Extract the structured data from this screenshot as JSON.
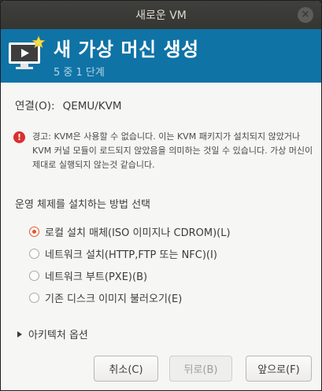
{
  "window": {
    "title": "새로운 VM",
    "close_glyph": "×"
  },
  "banner": {
    "title": "새 가상 머신 생성",
    "step": "5 중 1 단계",
    "background": "#0f73a6"
  },
  "connection": {
    "label": "연결(O):",
    "value": "QEMU/KVM"
  },
  "warning": {
    "text": "경고: KVM은 사용할 수 없습니다. 이는 KVM 패키지가 설치되지 않았거나 KVM 커널 모듈이 로드되지 않았음을 의미하는 것일 수 있습니다. 가상 머신이 제대로 실행되지 않는것 같습니다.",
    "glyph": "!"
  },
  "install_method": {
    "title": "운영 체제를 설치하는 방법 선택",
    "options": [
      {
        "label": "로컬 설치 매체(ISO 이미지나 CDROM)(L)",
        "selected": true
      },
      {
        "label": "네트워크 설치(HTTP,FTP 또는 NFC)(I)",
        "selected": false
      },
      {
        "label": "네트워크 부트(PXE)(B)",
        "selected": false
      },
      {
        "label": "기존 디스크 이미지 불러오기(E)",
        "selected": false
      }
    ]
  },
  "architecture": {
    "label": "아키텍처 옵션"
  },
  "buttons": {
    "cancel": "취소(C)",
    "back": "뒤로(B)",
    "forward": "앞으로(F)"
  }
}
